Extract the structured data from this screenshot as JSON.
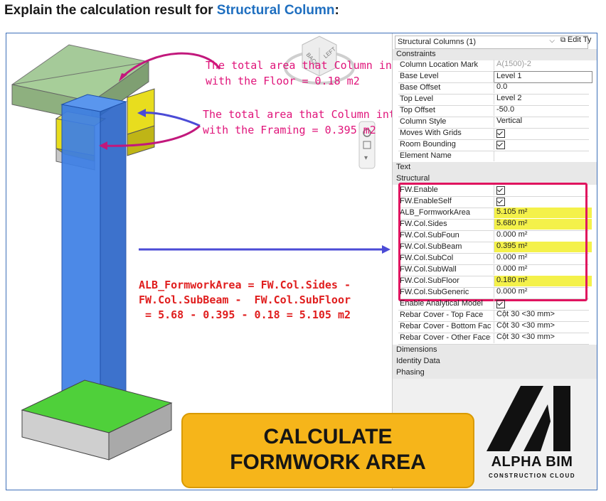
{
  "heading": {
    "prefix": "Explain the calculation result for ",
    "highlight": "Structural Column",
    "suffix": ":"
  },
  "annotations": {
    "floor": [
      "The total area that Column intersects",
      "with the Floor = 0.18 m2"
    ],
    "framing": [
      "The total area that Column intersects",
      "with the Framing = 0.395 m2"
    ],
    "formula": [
      "ALB_FormworkArea = FW.Col.Sides -",
      "FW.Col.SubBeam -  FW.Col.SubFloor",
      " = 5.68 - 0.395 - 0.18 = 5.105 m2"
    ]
  },
  "viewcube": {
    "face_back": "BACK",
    "face_left": "LEFT"
  },
  "properties": {
    "selector": "Structural Columns (1)",
    "edit_type": "Edit Ty",
    "groups": {
      "constraints": "Constraints",
      "text": "Text",
      "structural": "Structural",
      "dimensions": "Dimensions",
      "identity": "Identity Data",
      "phasing": "Phasing"
    },
    "rows": [
      {
        "name": "Column Location Mark",
        "value": "A(1500)-2"
      },
      {
        "name": "Base Level",
        "value": "Level 1"
      },
      {
        "name": "Base Offset",
        "value": "0.0"
      },
      {
        "name": "Top Level",
        "value": "Level 2"
      },
      {
        "name": "Top Offset",
        "value": "-50.0"
      },
      {
        "name": "Column Style",
        "value": "Vertical"
      },
      {
        "name": "Moves With Grids",
        "value": "checked"
      },
      {
        "name": "Room Bounding",
        "value": "checked"
      },
      {
        "name": "Element Name",
        "value": ""
      }
    ],
    "fw_rows": [
      {
        "name": "FW.Enable",
        "value": "checked"
      },
      {
        "name": "FW.EnableSelf",
        "value": "checked"
      },
      {
        "name": "ALB_FormworkArea",
        "value": "5.105 m²"
      },
      {
        "name": "FW.Col.Sides",
        "value": "5.680 m²"
      },
      {
        "name": "FW.Col.SubFoun",
        "value": "0.000 m²"
      },
      {
        "name": "FW.Col.SubBeam",
        "value": "0.395 m²"
      },
      {
        "name": "FW.Col.SubCol",
        "value": "0.000 m²"
      },
      {
        "name": "FW.Col.SubWall",
        "value": "0.000 m²"
      },
      {
        "name": "FW.Col.SubFloor",
        "value": "0.180 m²"
      },
      {
        "name": "FW.Col.SubGeneric",
        "value": "0.000 m²"
      }
    ],
    "post_rows": [
      {
        "name": "Enable Analytical Model",
        "value": "checked"
      },
      {
        "name": "Rebar Cover - Top Face",
        "value": "Cột 30 <30 mm>"
      },
      {
        "name": "Rebar Cover - Bottom Face",
        "value": "Cột 30 <30 mm>"
      },
      {
        "name": "Rebar Cover - Other Faces",
        "value": "Cột 30 <30 mm>"
      }
    ]
  },
  "banner": {
    "line1": "CALCULATE",
    "line2": "FORMWORK AREA"
  },
  "logo": {
    "brand": "ALPHA BIM",
    "tagline": "CONSTRUCTION CLOUD"
  },
  "colors": {
    "accent_blue": "#1f6fc0",
    "highlight_pink": "#e0145f",
    "banner": "#f6b51a",
    "annot_red": "#e01e1e"
  }
}
